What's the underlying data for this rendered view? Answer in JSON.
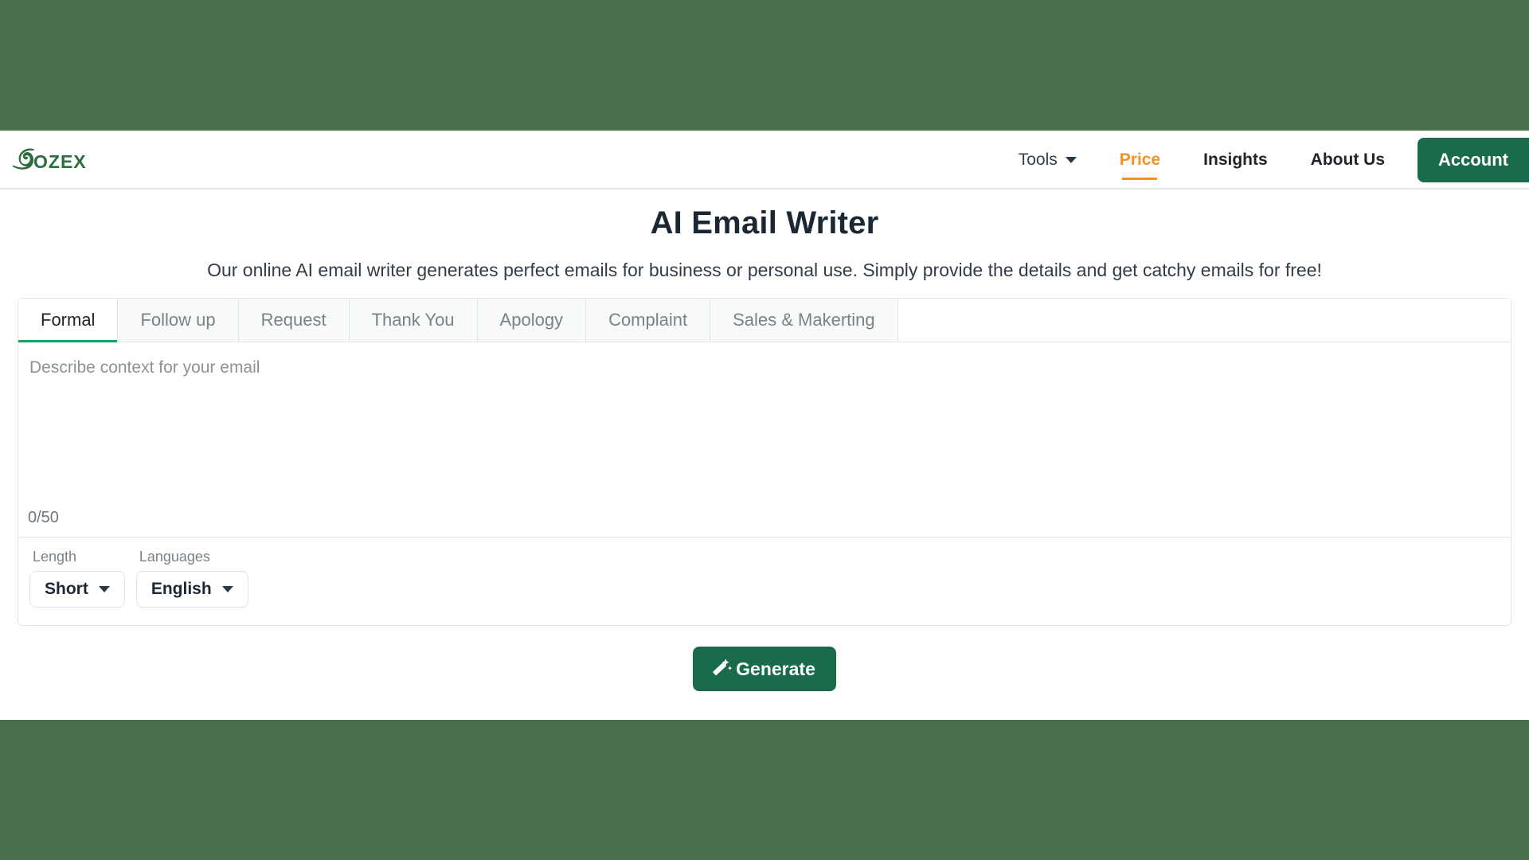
{
  "theme": {
    "page_bg": "#4a714c",
    "brand_green": "#1a6b4b",
    "accent_orange": "#f7921e",
    "tab_active_underline": "#1a9e62"
  },
  "header": {
    "logo_text": "QOZEX",
    "logo_icon": "qozex-swirl-logo",
    "nav": [
      {
        "label": "Tools",
        "type": "dropdown",
        "active": false,
        "icon": "chevron-down-icon"
      },
      {
        "label": "Price",
        "type": "link",
        "active": true
      },
      {
        "label": "Insights",
        "type": "link",
        "active": false
      },
      {
        "label": "About Us",
        "type": "link",
        "active": false
      }
    ],
    "account_label": "Account"
  },
  "hero": {
    "title": "AI Email Writer",
    "subtitle": "Our online AI email writer generates perfect emails for business or personal use. Simply provide the details and get catchy emails for free!"
  },
  "card": {
    "tabs": [
      {
        "label": "Formal",
        "active": true
      },
      {
        "label": "Follow up",
        "active": false
      },
      {
        "label": "Request",
        "active": false
      },
      {
        "label": "Thank You",
        "active": false
      },
      {
        "label": "Apology",
        "active": false
      },
      {
        "label": "Complaint",
        "active": false
      },
      {
        "label": "Sales & Makerting",
        "active": false
      }
    ],
    "textarea": {
      "placeholder": "Describe context for your email",
      "value": "",
      "counter": "0/50"
    },
    "controls": [
      {
        "label": "Length",
        "value": "Short",
        "icon": "chevron-down-icon"
      },
      {
        "label": "Languages",
        "value": "English",
        "icon": "chevron-down-icon"
      }
    ]
  },
  "actions": {
    "generate_label": "Generate",
    "generate_icon": "magic-wand-icon"
  }
}
